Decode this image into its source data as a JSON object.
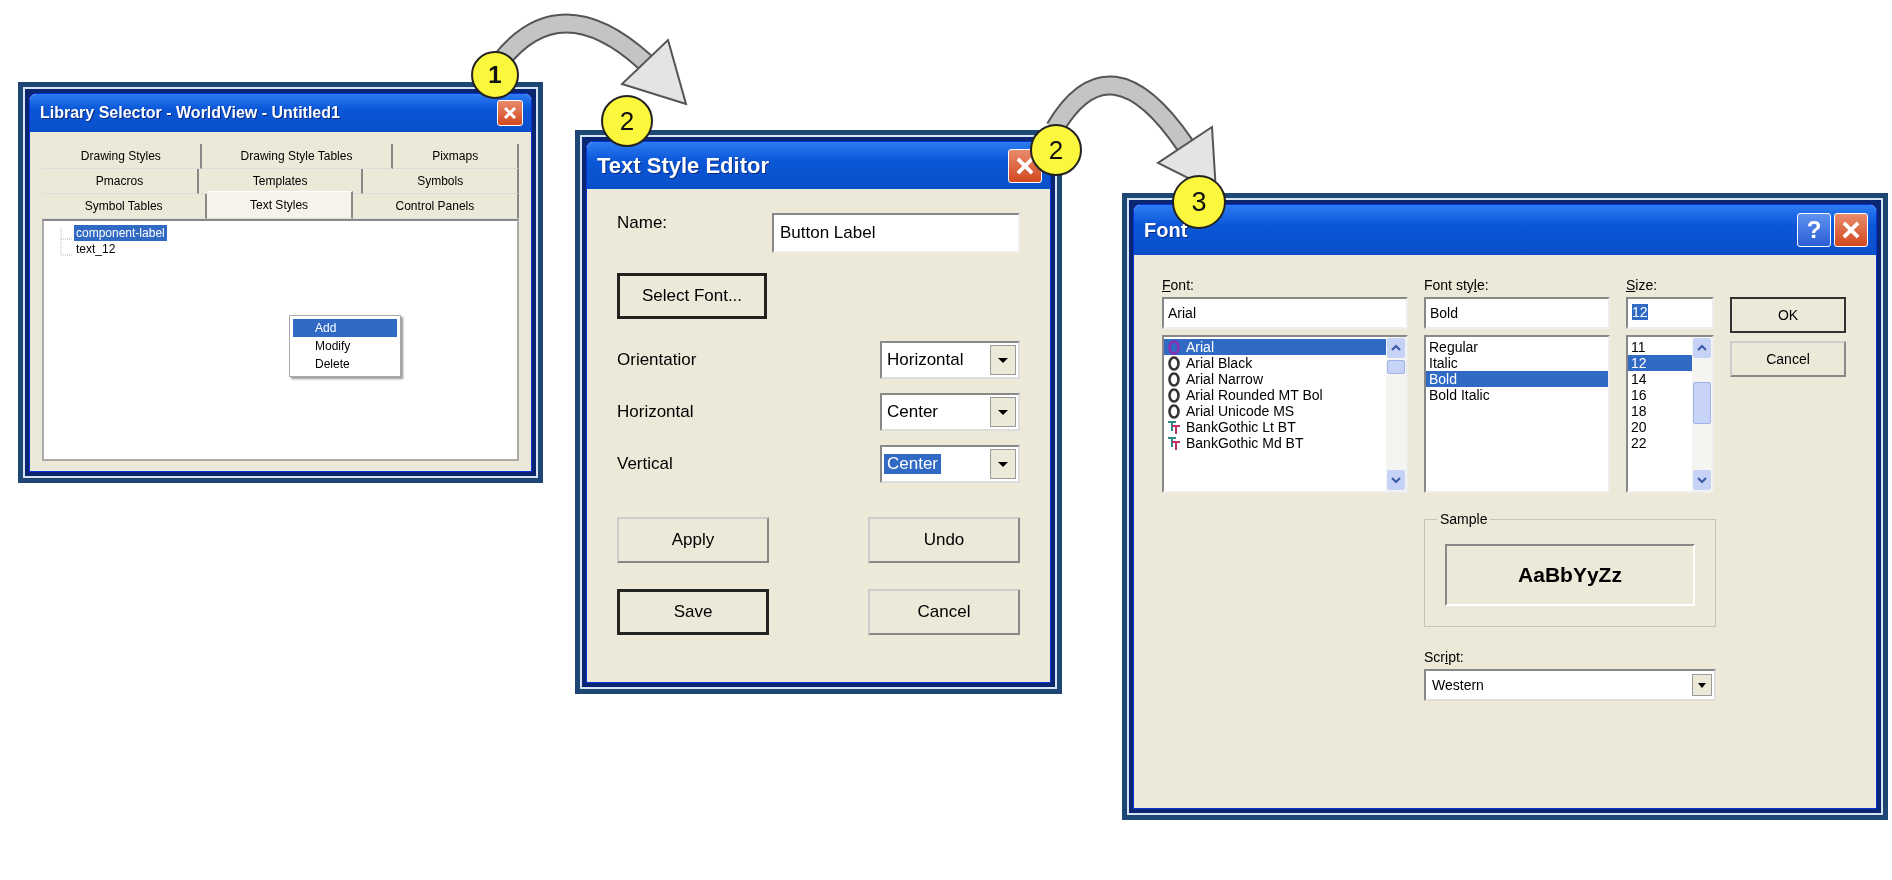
{
  "step_badges": [
    {
      "label": "1"
    },
    {
      "label": "2"
    },
    {
      "label": "2"
    },
    {
      "label": "3"
    }
  ],
  "library_selector": {
    "title": "Library Selector - WorldView - Untitled1",
    "tab_rows": [
      {
        "tabs": [
          {
            "label": "Drawing Styles",
            "selected": false
          },
          {
            "label": "Drawing Style Tables",
            "selected": false
          },
          {
            "label": "Pixmaps",
            "selected": false
          }
        ]
      },
      {
        "tabs": [
          {
            "label": "Pmacros",
            "selected": false
          },
          {
            "label": "Templates",
            "selected": false
          },
          {
            "label": "Symbols",
            "selected": false
          }
        ]
      },
      {
        "tabs": [
          {
            "label": "Symbol Tables",
            "selected": false
          },
          {
            "label": "Text Styles",
            "selected": true
          },
          {
            "label": "Control Panels",
            "selected": false
          }
        ]
      }
    ],
    "tree_items": [
      {
        "label": "component-label",
        "selected": true
      },
      {
        "label": "text_12",
        "selected": false
      }
    ],
    "context_menu": [
      {
        "label": "Add",
        "selected": true
      },
      {
        "label": "Modify",
        "selected": false
      },
      {
        "label": "Delete",
        "selected": false
      }
    ]
  },
  "text_style_editor": {
    "title": "Text Style Editor",
    "name_label": "Name:",
    "name_value": "Button Label",
    "select_font_button": {
      "label": "Select Font...",
      "default": true
    },
    "options": [
      {
        "label": "Orientatior",
        "value": "Horizontal",
        "highlighted": false
      },
      {
        "label": "Horizontal",
        "value": "Center",
        "highlighted": false
      },
      {
        "label": "Vertical",
        "value": "Center",
        "highlighted": true
      }
    ],
    "buttons": [
      {
        "label": "Apply",
        "default": false
      },
      {
        "label": "Undo",
        "default": false
      },
      {
        "label": "Save",
        "default": true
      },
      {
        "label": "Cancel",
        "default": false
      }
    ]
  },
  "font_dialog": {
    "title": "Font",
    "help_button": "?",
    "font": {
      "label": "Font:",
      "value": "Arial",
      "items": [
        {
          "label": "Arial",
          "kind": "opentype",
          "selected": true
        },
        {
          "label": "Arial Black",
          "kind": "opentype",
          "selected": false
        },
        {
          "label": "Arial Narrow",
          "kind": "opentype",
          "selected": false
        },
        {
          "label": "Arial Rounded MT Bol",
          "kind": "opentype",
          "selected": false
        },
        {
          "label": "Arial Unicode MS",
          "kind": "opentype",
          "selected": false
        },
        {
          "label": "BankGothic Lt BT",
          "kind": "truetype",
          "selected": false
        },
        {
          "label": "BankGothic Md BT",
          "kind": "truetype",
          "selected": false
        }
      ]
    },
    "style": {
      "label": "Font style:",
      "value": "Bold",
      "items": [
        {
          "label": "Regular",
          "selected": false
        },
        {
          "label": "Italic",
          "selected": false
        },
        {
          "label": "Bold",
          "selected": true
        },
        {
          "label": "Bold Italic",
          "selected": false
        }
      ]
    },
    "size": {
      "label": "Size:",
      "value": "12",
      "value_highlighted": true,
      "items": [
        {
          "label": "11",
          "selected": false
        },
        {
          "label": "12",
          "selected": true
        },
        {
          "label": "14",
          "selected": false
        },
        {
          "label": "16",
          "selected": false
        },
        {
          "label": "18",
          "selected": false
        },
        {
          "label": "20",
          "selected": false
        },
        {
          "label": "22",
          "selected": false
        }
      ]
    },
    "buttons": [
      {
        "label": "OK",
        "default": true
      },
      {
        "label": "Cancel",
        "default": false
      }
    ],
    "sample": {
      "label": "Sample",
      "text": "AaBbYyZz"
    },
    "script": {
      "label": "Script:",
      "value": "Western"
    }
  }
}
